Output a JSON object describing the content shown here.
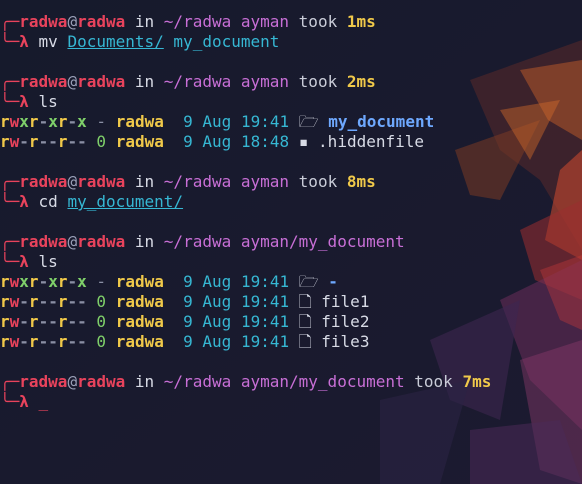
{
  "blocks": [
    {
      "prompt": {
        "user": "radwa",
        "at": "@",
        "host": "radwa",
        "in": "in",
        "path": "~/radwa ayman",
        "took": "took",
        "duration": "1ms"
      },
      "command": {
        "symbol": "λ",
        "cmd": "mv",
        "arg1": "Documents/",
        "arg2": "my_document"
      }
    },
    {
      "prompt": {
        "user": "radwa",
        "at": "@",
        "host": "radwa",
        "in": "in",
        "path": "~/radwa ayman",
        "took": "took",
        "duration": "2ms"
      },
      "command": {
        "symbol": "λ",
        "cmd": "ls"
      },
      "listing": [
        {
          "perms": "rwxr-xr-x",
          "size": "-",
          "owner": "radwa",
          "day": "9",
          "month": "Aug",
          "time": "19:41",
          "icon": "folder-icon",
          "name": "my_document"
        },
        {
          "perms": "rw-r--r--",
          "size": "0",
          "owner": "radwa",
          "day": "9",
          "month": "Aug",
          "time": "18:48",
          "icon": "file-icon",
          "name": ".hiddenfile"
        }
      ]
    },
    {
      "prompt": {
        "user": "radwa",
        "at": "@",
        "host": "radwa",
        "in": "in",
        "path": "~/radwa ayman",
        "took": "took",
        "duration": "8ms"
      },
      "command": {
        "symbol": "λ",
        "cmd": "cd",
        "arg1": "my_document/"
      }
    },
    {
      "prompt": {
        "user": "radwa",
        "at": "@",
        "host": "radwa",
        "in": "in",
        "path": "~/radwa ayman/my_document"
      },
      "command": {
        "symbol": "λ",
        "cmd": "ls"
      },
      "listing": [
        {
          "perms": "rwxr-xr-x",
          "size": "-",
          "owner": "radwa",
          "day": "9",
          "month": "Aug",
          "time": "19:41",
          "icon": "folder-icon",
          "name": "-"
        },
        {
          "perms": "rw-r--r--",
          "size": "0",
          "owner": "radwa",
          "day": "9",
          "month": "Aug",
          "time": "19:41",
          "icon": "file-icon",
          "name": "file1"
        },
        {
          "perms": "rw-r--r--",
          "size": "0",
          "owner": "radwa",
          "day": "9",
          "month": "Aug",
          "time": "19:41",
          "icon": "file-icon",
          "name": "file2"
        },
        {
          "perms": "rw-r--r--",
          "size": "0",
          "owner": "radwa",
          "day": "9",
          "month": "Aug",
          "time": "19:41",
          "icon": "file-icon",
          "name": "file3"
        }
      ]
    },
    {
      "prompt": {
        "user": "radwa",
        "at": "@",
        "host": "radwa",
        "in": "in",
        "path": "~/radwa ayman/my_document",
        "took": "took",
        "duration": "7ms"
      },
      "command": {
        "symbol": "λ",
        "cursor": "_"
      }
    }
  ],
  "colors": {
    "background": "#161a2c",
    "prompt_red": "#e8435c",
    "path_purple": "#c86fd6",
    "duration_yellow": "#f0c94a",
    "link_cyan": "#36b7d3",
    "dir_blue": "#6ea8fe"
  }
}
